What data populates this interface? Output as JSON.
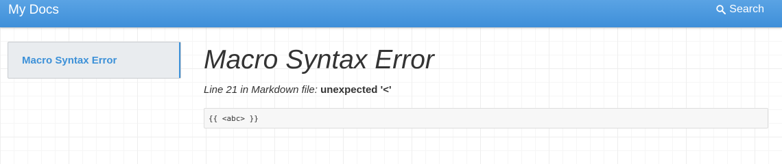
{
  "navbar": {
    "brand": "My Docs",
    "search_label": "Search",
    "color": "#4a98df"
  },
  "sidebar": {
    "items": [
      {
        "label": "Macro Syntax Error",
        "active": true
      }
    ]
  },
  "main": {
    "title": "Macro Syntax Error",
    "location": "Line 21 in Markdown file:",
    "message": "unexpected '<'",
    "code": "{{ <abc> }}"
  },
  "icons": {
    "search": "search-icon"
  }
}
